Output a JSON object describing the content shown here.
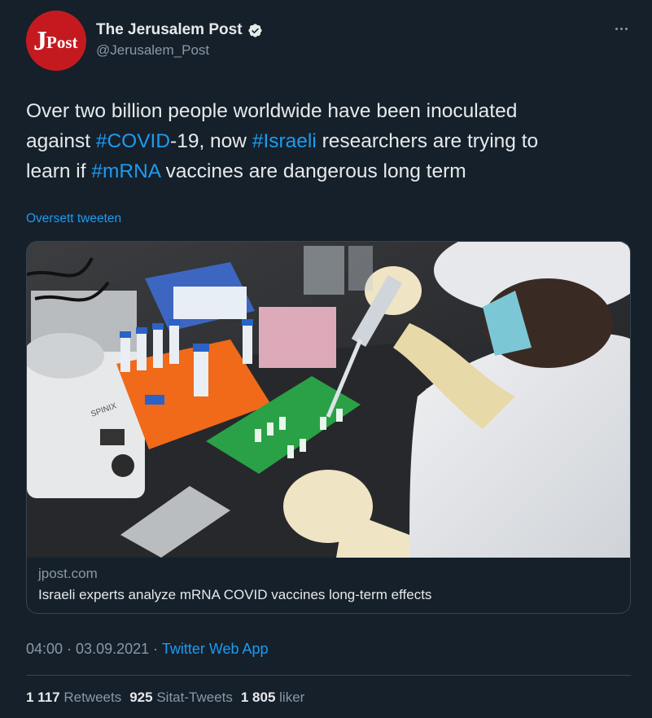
{
  "author": {
    "name": "The Jerusalem Post",
    "handle": "@Jerusalem_Post",
    "avatar_text": "JPost",
    "verified": true
  },
  "tweet": {
    "lines": [
      [
        {
          "text": "Over two billion people worldwide have been inoculated",
          "hashtag": false
        }
      ],
      [
        {
          "text": "against ",
          "hashtag": false
        },
        {
          "text": "#COVID",
          "hashtag": true
        },
        {
          "text": "-19, now ",
          "hashtag": false
        },
        {
          "text": "#Israeli",
          "hashtag": true
        },
        {
          "text": " researchers are trying to",
          "hashtag": false
        }
      ],
      [
        {
          "text": "learn if ",
          "hashtag": false
        },
        {
          "text": "#mRNA",
          "hashtag": true
        },
        {
          "text": " vaccines are dangerous long term",
          "hashtag": false
        }
      ]
    ],
    "translate_label": "Oversett tweeten"
  },
  "card": {
    "domain": "jpost.com",
    "title": "Israeli experts analyze mRNA COVID vaccines long-term effects",
    "image_label": "SPINIX"
  },
  "meta": {
    "time": "04:00",
    "date": "03.09.2021",
    "separator": " · ",
    "source": "Twitter Web App"
  },
  "stats": [
    {
      "count": "1 117",
      "label": "Retweets"
    },
    {
      "count": "925",
      "label": "Sitat-Tweets"
    },
    {
      "count": "1 805",
      "label": "liker"
    }
  ],
  "icons": {
    "more": "more-horizontal-icon",
    "verified": "verified-badge-icon"
  },
  "colors": {
    "background": "#15202b",
    "accent": "#1d9bf0",
    "secondary_text": "#8b98a5",
    "brand_red": "#c41a1f"
  }
}
